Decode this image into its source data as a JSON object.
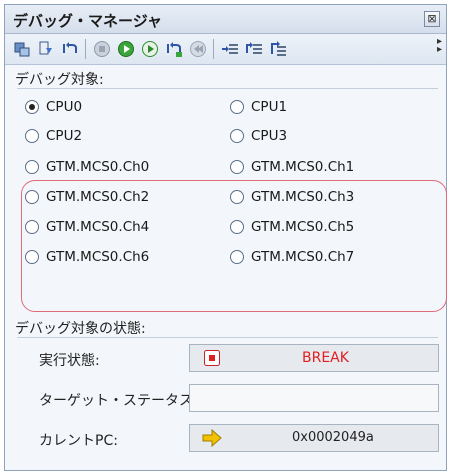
{
  "window": {
    "title": "デバッグ・マネージャ",
    "close_glyph": "⊠"
  },
  "toolbar": {
    "icons": [
      "connect-icon",
      "download-icon",
      "reset-icon",
      "stop-icon",
      "run-icon",
      "run-from-reset-icon",
      "step-return-icon",
      "return-icon",
      "step-in-icon",
      "step-over-icon",
      "step-out-icon"
    ],
    "more_glyph": "⁚"
  },
  "debug_target": {
    "section_title": "デバッグ対象:",
    "options": [
      {
        "label": "CPU0",
        "checked": true
      },
      {
        "label": "CPU1",
        "checked": false
      },
      {
        "label": "CPU2",
        "checked": false
      },
      {
        "label": "CPU3",
        "checked": false
      },
      {
        "label": "GTM.MCS0.Ch0",
        "checked": false
      },
      {
        "label": "GTM.MCS0.Ch1",
        "checked": false
      },
      {
        "label": "GTM.MCS0.Ch2",
        "checked": false
      },
      {
        "label": "GTM.MCS0.Ch3",
        "checked": false
      },
      {
        "label": "GTM.MCS0.Ch4",
        "checked": false
      },
      {
        "label": "GTM.MCS0.Ch5",
        "checked": false
      },
      {
        "label": "GTM.MCS0.Ch6",
        "checked": false
      },
      {
        "label": "GTM.MCS0.Ch7",
        "checked": false
      }
    ]
  },
  "target_state": {
    "section_title": "デバッグ対象の状態:",
    "exec_label": "実行状態:",
    "exec_value": "BREAK",
    "status_label": "ターゲット・ステータス:",
    "status_value": "",
    "pc_label": "カレントPC:",
    "pc_value": "0x0002049a"
  },
  "colors": {
    "break_red": "#e02020",
    "highlight_outline": "#e06a7a",
    "arrow_yellow": "#f2c200"
  }
}
